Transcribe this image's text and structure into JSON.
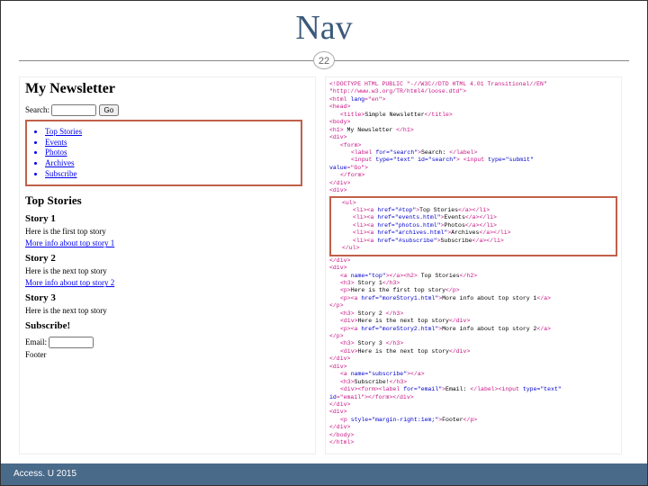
{
  "slide": {
    "title": "Nav",
    "badge": "22",
    "footer": "Access. U 2015"
  },
  "left": {
    "heading": "My Newsletter",
    "search_label": "Search:",
    "go_label": "Go",
    "nav": [
      "Top Stories",
      "Events",
      "Photos",
      "Archives",
      "Subscribe"
    ],
    "section_heading": "Top Stories",
    "stories": [
      {
        "title": "Story 1",
        "body": "Here is the first top story",
        "more": "More info about top story 1"
      },
      {
        "title": "Story 2",
        "body": "Here is the next top story",
        "more": "More info about top story 2"
      },
      {
        "title": "Story 3",
        "body": "Here is the next top story",
        "more": ""
      }
    ],
    "subscribe_heading": "Subscribe!",
    "email_label": "Email:",
    "footer_text": "Footer"
  },
  "right": {
    "l0": "<!DOCTYPE HTML PUBLIC \"-//W3C//DTD HTML 4.01 Transitional//EN\"",
    "l1": "\"http://www.w3.org/TR/html4/loose.dtd\">",
    "l2a": "<html",
    "l2b": " lang",
    "l2c": "=\"en\">",
    "l3": "<head>",
    "l4a": "<title>",
    "l4b": "Simple Newsletter",
    "l4c": "</title>",
    "l5": "<body>",
    "l6a": "<h1>",
    "l6b": " My Newsletter ",
    "l6c": "</h1>",
    "l7": "<div>",
    "l8": "<form>",
    "l9a": "<label ",
    "l9b": "for=\"search\"",
    "l9c": ">",
    "l9d": "Search: ",
    "l9e": "</label>",
    "l10a": "<input ",
    "l10b": "type=\"text\" id=\"search\"",
    "l10c": "> <input ",
    "l10d": "type=\"submit\"",
    "l11a": "value",
    "l11b": "=\"Go\">",
    "l12": "</form>",
    "l13": "</div>",
    "l14": "<div>",
    "ul_open": "<ul>",
    "li1a": "<li><a ",
    "li1b": "href=\"#top\"",
    "li1c": ">",
    "li1d": "Top Stories",
    "li1e": "</a></li>",
    "li2a": "<li><a ",
    "li2b": "href=\"events.html\"",
    "li2c": ">",
    "li2d": "Events",
    "li2e": "</a></li>",
    "li3a": "<li><a ",
    "li3b": "href=\"photos.html\"",
    "li3c": ">",
    "li3d": "Photos",
    "li3e": "</a></li>",
    "li4a": "<li><a ",
    "li4b": "href=\"archives.html\"",
    "li4c": ">",
    "li4d": "Archives",
    "li4e": "</a></li>",
    "li5a": "<li><a ",
    "li5b": "href=\"#subscribe\"",
    "li5c": ">",
    "li5d": "Subscribe",
    "li5e": "</a></li>",
    "ul_close": "</ul>",
    "l15": "</div>",
    "l16": "<div>",
    "l17a": "<a ",
    "l17b": "name=\"top\"",
    "l17c": "></a><h2>",
    "l17d": " Top Stories",
    "l17e": "</h2>",
    "l18a": "<h3>",
    "l18b": " Story 1",
    "l18c": "</h3>",
    "l19a": "<p>",
    "l19b": "Here is the first top story",
    "l19c": "</p>",
    "l20a": "<p><a ",
    "l20b": "href=\"moreStory1.html\"",
    "l20c": ">",
    "l20d": "More info about top story 1",
    "l20e": "</a>",
    "l21": "</p>",
    "l22a": "<h3>",
    "l22b": " Story 2 ",
    "l22c": "</h3>",
    "l23a": "<div>",
    "l23b": "Here is the next top story",
    "l23c": "</div>",
    "l24a": "<p><a ",
    "l24b": "href=\"moreStory2.html\"",
    "l24c": ">",
    "l24d": "More info about top story 2",
    "l24e": "</a>",
    "l25": "</p>",
    "l26a": "<h3>",
    "l26b": " Story 3 ",
    "l26c": "</h3>",
    "l27a": "<div>",
    "l27b": "Here is the next top story",
    "l27c": "</div>",
    "l28": "</div>",
    "l29": "<div>",
    "l30a": "<a ",
    "l30b": "name=\"subscribe\"",
    "l30c": "></a>",
    "l31a": "<h3>",
    "l31b": "Subscribe!",
    "l31c": "</h3>",
    "l32a": "<div><form><label ",
    "l32b": "for=\"email\"",
    "l32c": ">",
    "l32d": "Email: ",
    "l32e": "</label><input ",
    "l32f": "type=\"text\"",
    "l33a": "id",
    "l33b": "=\"email\"></form></div>",
    "l34": "</div>",
    "l35": "<div>",
    "l36a": "<p ",
    "l36b": "style=\"margin-right:1em;\"",
    "l36c": ">",
    "l36d": "Footer",
    "l36e": "</p>",
    "l37": "</div>",
    "l38": "</body>",
    "l39": "</html>"
  }
}
